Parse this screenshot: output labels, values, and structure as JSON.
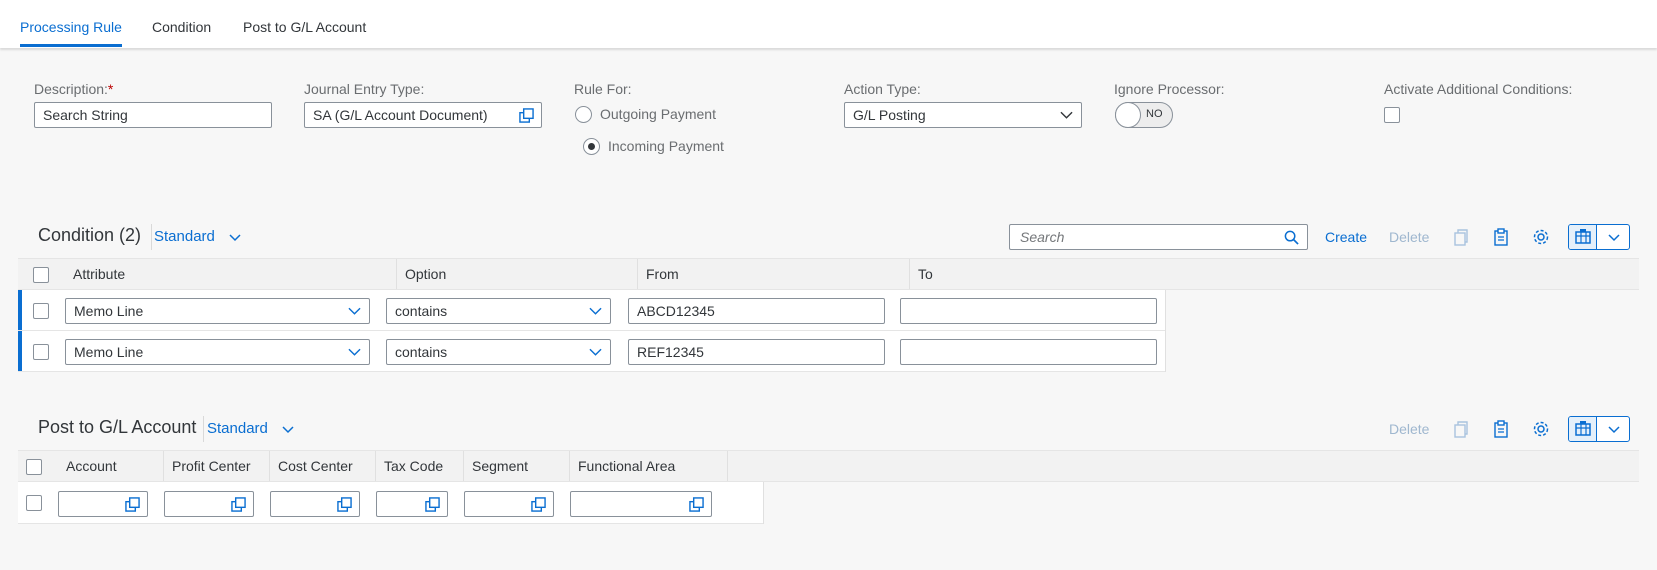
{
  "tabs": [
    {
      "label": "Processing Rule",
      "active": true
    },
    {
      "label": "Condition",
      "active": false
    },
    {
      "label": "Post to G/L Account",
      "active": false
    }
  ],
  "form": {
    "description": {
      "label": "Description:",
      "required_mark": "*",
      "value": "Search String"
    },
    "journal_entry_type": {
      "label": "Journal Entry Type:",
      "value": "SA (G/L Account Document)"
    },
    "rule_for": {
      "label": "Rule For:",
      "options": [
        "Outgoing Payment",
        "Incoming Payment"
      ],
      "selected": "Incoming Payment"
    },
    "action_type": {
      "label": "Action Type:",
      "value": "G/L Posting"
    },
    "ignore_processor": {
      "label": "Ignore Processor:",
      "state": "NO"
    },
    "activate_additional_conditions": {
      "label": "Activate Additional Conditions:",
      "checked": false
    }
  },
  "condition_table": {
    "title": "Condition (2)",
    "variant": "Standard",
    "search_placeholder": "Search",
    "create_label": "Create",
    "delete_label": "Delete",
    "columns": [
      "Attribute",
      "Option",
      "From",
      "To"
    ],
    "rows": [
      {
        "attribute": "Memo Line",
        "option": "contains",
        "from": "ABCD12345",
        "to": ""
      },
      {
        "attribute": "Memo Line",
        "option": "contains",
        "from": "REF12345",
        "to": ""
      }
    ]
  },
  "gl_table": {
    "title": "Post to G/L Account",
    "variant": "Standard",
    "delete_label": "Delete",
    "columns": [
      "Account",
      "Profit Center",
      "Cost Center",
      "Tax Code",
      "Segment",
      "Functional Area"
    ],
    "rows": [
      {
        "account": "",
        "profit_center": "",
        "cost_center": "",
        "tax_code": "",
        "segment": "",
        "functional_area": ""
      }
    ]
  },
  "colors": {
    "accent": "#0a6ed1",
    "required": "#bb0000",
    "background": "#f7f7f7"
  }
}
